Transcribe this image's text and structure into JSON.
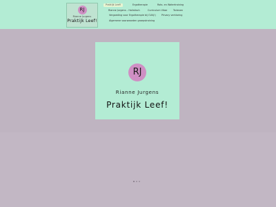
{
  "logo": {
    "initials": "RJ",
    "name": "Rianne Jurgens",
    "brand": "Praktijk Leef!"
  },
  "nav": {
    "items": [
      {
        "label": "Praktijk Leef!",
        "active": true
      },
      {
        "label": "Ergotherapie"
      },
      {
        "label": "Rots- en Watertraining"
      },
      {
        "label": "Rianne Jurgens – Holistisch"
      },
      {
        "label": "Curriculum Vitae"
      },
      {
        "label": "Tarieven"
      },
      {
        "label": "Vergoeding voor Ergotherapie bij CVA(!)"
      },
      {
        "label": "Privacy verklaring"
      },
      {
        "label": "Algemene voorwaarden groepstraining"
      }
    ]
  },
  "hero": {
    "initials": "RJ",
    "name": "Rianne Jurgens",
    "brand": "Praktijk Leef!"
  },
  "slider": {
    "dots": 3,
    "active_index": 0
  },
  "colors": {
    "header_bg": "#b3ecd4",
    "page_bg": "#c2b7c4",
    "badge": "#cf8fc4"
  }
}
